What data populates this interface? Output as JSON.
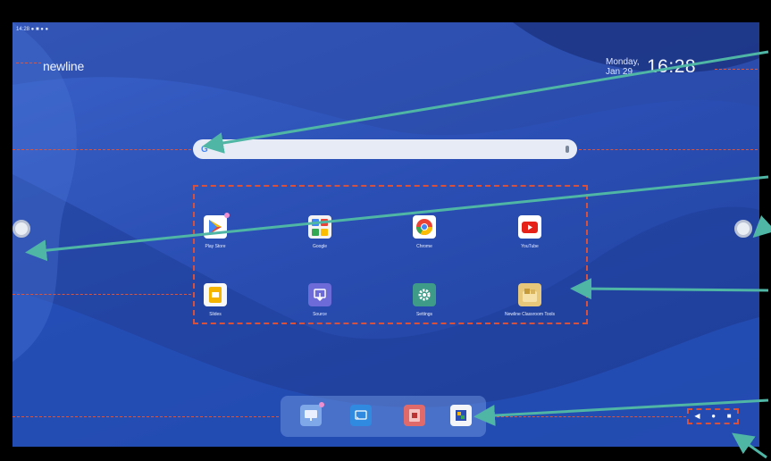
{
  "status_bar": {
    "text": "14:28 ● ■ ● ●"
  },
  "brand": {
    "logo": "newline"
  },
  "clock": {
    "date": "Monday, Jan 29",
    "time": "16:28"
  },
  "search": {
    "logo": "G"
  },
  "apps": [
    {
      "label": "Play Store",
      "icon": "play-store-icon",
      "color": "#ffffff"
    },
    {
      "label": "Google",
      "icon": "google-apps-icon",
      "color": "#f3f3f3"
    },
    {
      "label": "Chrome",
      "icon": "chrome-icon",
      "color": "#ffffff"
    },
    {
      "label": "YouTube",
      "icon": "youtube-icon",
      "color": "#ffffff"
    },
    {
      "label": "Slides",
      "icon": "slides-icon",
      "color": "#f8f8f8"
    },
    {
      "label": "Source",
      "icon": "source-icon",
      "color": "#6c6bd8"
    },
    {
      "label": "Settings",
      "icon": "settings-icon",
      "color": "#3d9b87"
    },
    {
      "label": "Newline Classroom Tools",
      "icon": "classroom-tools-icon",
      "color": "#e7c77a"
    }
  ],
  "dock": [
    {
      "icon": "whiteboard-icon",
      "color": "#7fa8e8"
    },
    {
      "icon": "cast-icon",
      "color": "#2f8ae0"
    },
    {
      "icon": "file-manager-icon",
      "color": "#e06a6a"
    },
    {
      "icon": "apps-launcher-icon",
      "color": "#f2f4f8"
    }
  ],
  "nav": {
    "back": "◀",
    "home": "●",
    "recents": "■"
  },
  "colors": {
    "wallpaper": "#2a4eb3",
    "guide": "#d9513b",
    "callout": "#4fb5a5"
  }
}
